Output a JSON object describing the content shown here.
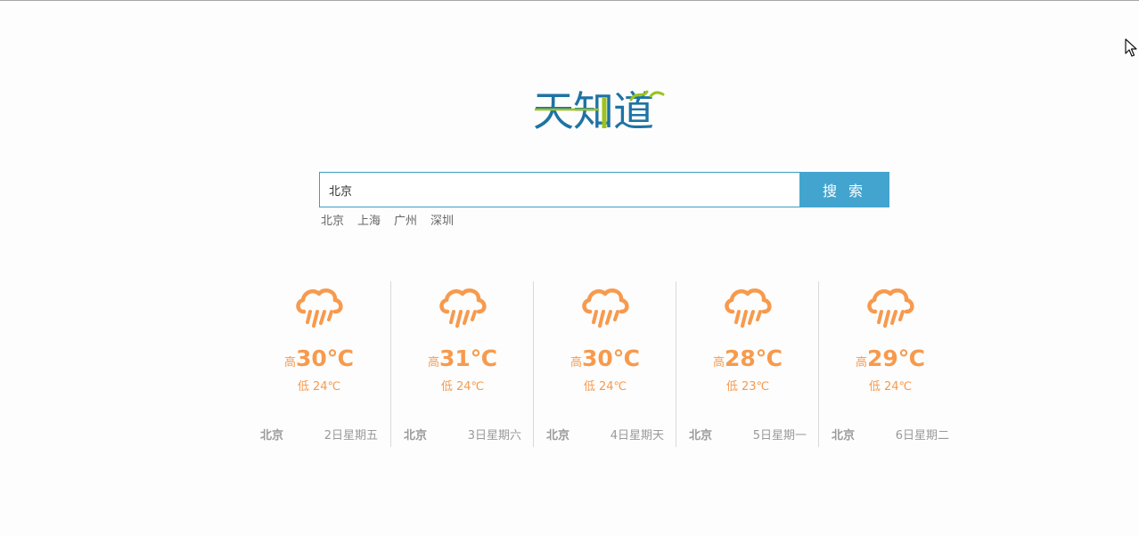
{
  "logo": {
    "text_chars": [
      "天",
      "知",
      "道"
    ],
    "primary_color": "#1e73a4",
    "accent_color": "#9cc31d"
  },
  "search": {
    "value": "北京",
    "placeholder": "",
    "button_label": "搜 索",
    "border_color": "#3b9fc6",
    "button_color": "#43a5cf"
  },
  "quick_links": [
    "北京",
    "上海",
    "广州",
    "深圳"
  ],
  "forecast": {
    "accent_color": "#f79a4d",
    "icon": "rain-cloud-icon",
    "days": [
      {
        "high_label": "高",
        "high": "30℃",
        "low": "低 24℃",
        "city": "北京",
        "date": "2日星期五"
      },
      {
        "high_label": "高",
        "high": "31℃",
        "low": "低 24℃",
        "city": "北京",
        "date": "3日星期六"
      },
      {
        "high_label": "高",
        "high": "30℃",
        "low": "低 24℃",
        "city": "北京",
        "date": "4日星期天"
      },
      {
        "high_label": "高",
        "high": "28℃",
        "low": "低 23℃",
        "city": "北京",
        "date": "5日星期一"
      },
      {
        "high_label": "高",
        "high": "29℃",
        "low": "低 24℃",
        "city": "北京",
        "date": "6日星期二"
      }
    ]
  }
}
